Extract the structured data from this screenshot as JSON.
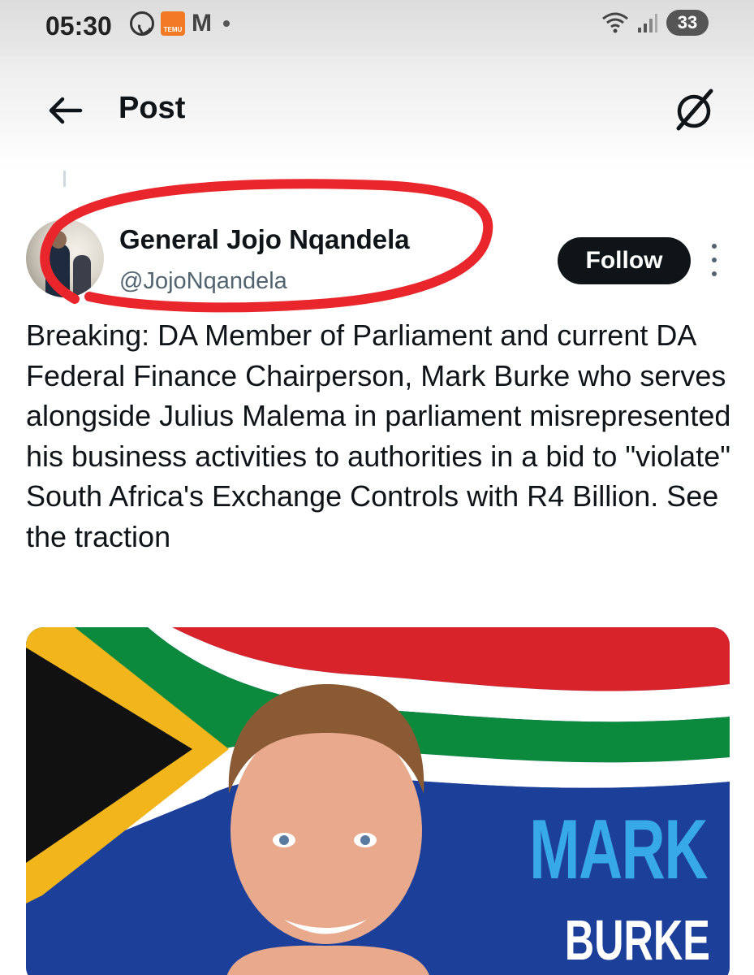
{
  "status_bar": {
    "time": "05:30",
    "temu_label": "TEMU",
    "gmail_label": "M",
    "battery": "33"
  },
  "header": {
    "title": "Post"
  },
  "post": {
    "display_name": "General Jojo Nqandela",
    "handle": "@JojoNqandela",
    "follow_label": "Follow",
    "text": "Breaking: DA Member of Parliament and current DA Federal Finance Chairperson, Mark Burke who serves alongside Julius Malema in parliament misrepresented his business activities to authorities in a bid to \"violate\" South Africa's Exchange Controls with R4 Billion. See the traction",
    "media": {
      "name_line_1": "MARK",
      "name_line_2": "BURKE"
    }
  },
  "colors": {
    "follow_bg": "#0f1419",
    "handle": "#536471",
    "annotation": "#e8262b",
    "name_blue": "#37a8e8"
  },
  "icons": {
    "back": "arrow-left-icon",
    "grok": "grok-icon",
    "more": "more-vertical-icon"
  }
}
